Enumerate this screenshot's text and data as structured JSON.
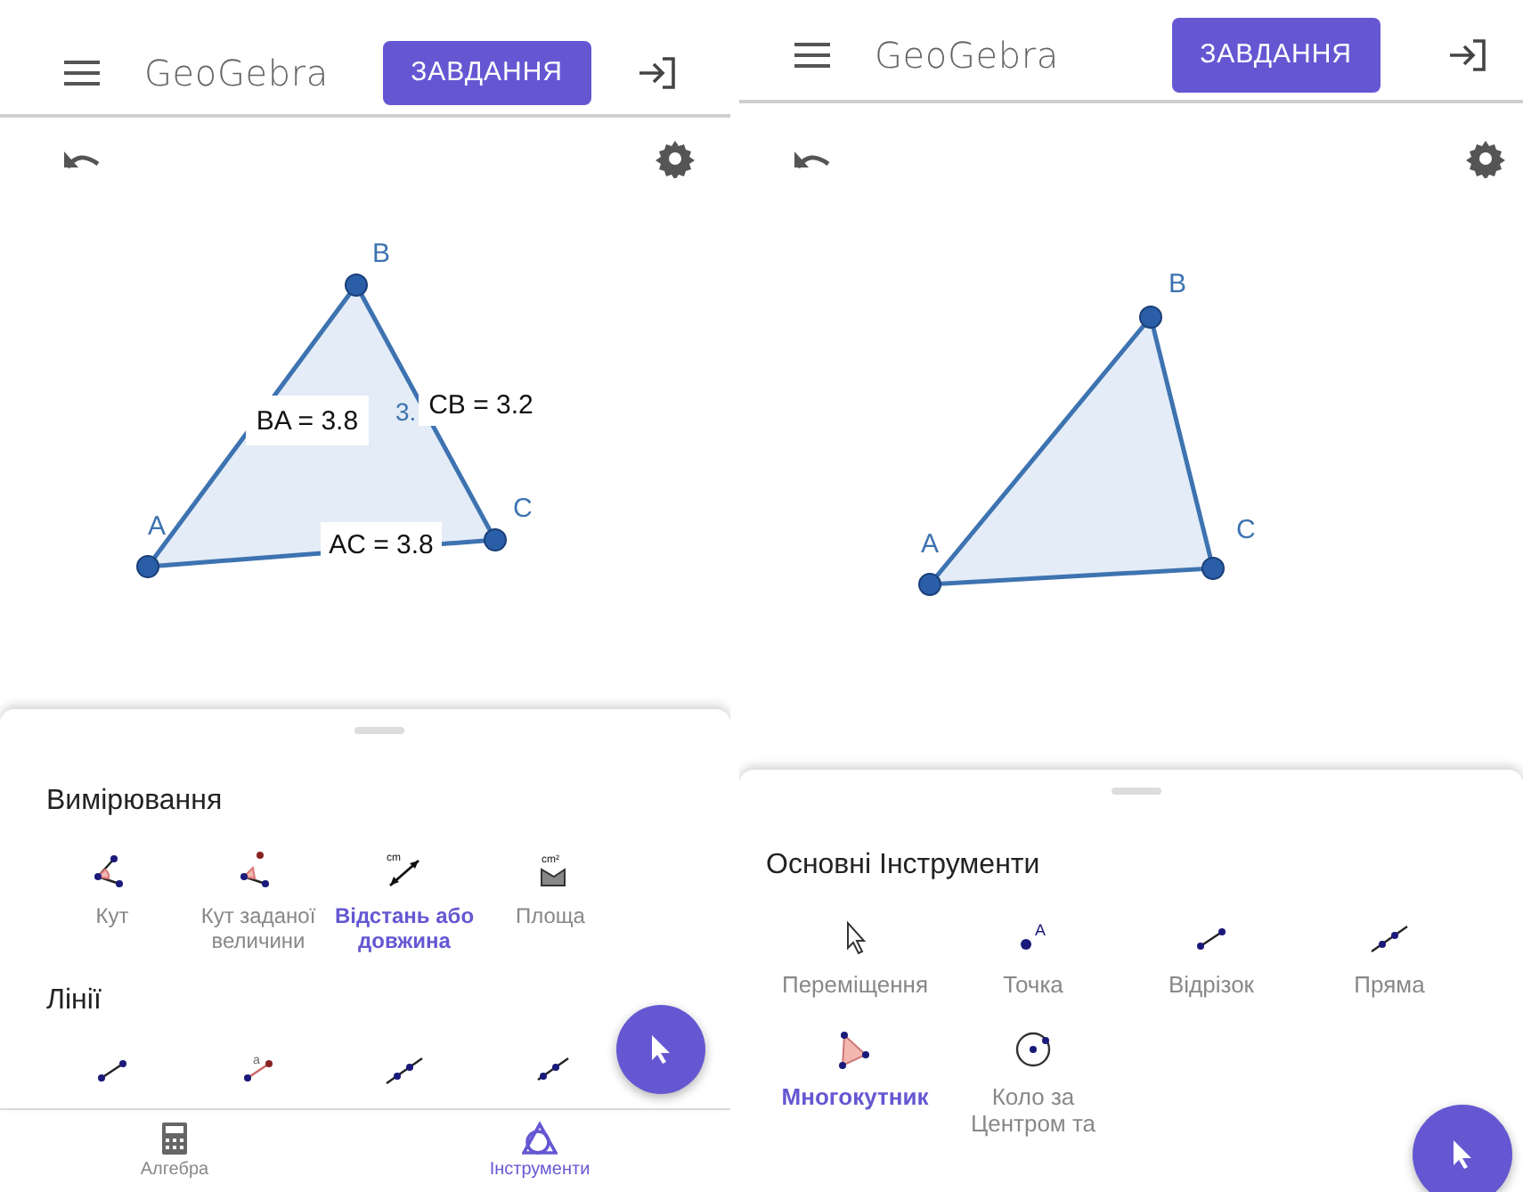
{
  "screens": [
    {
      "header": {
        "logo": "GeoGebra",
        "button": "ЗАВДАННЯ"
      },
      "construction": {
        "points": [
          {
            "label": "A"
          },
          {
            "label": "B"
          },
          {
            "label": "C"
          }
        ],
        "measures": [
          {
            "text": "BA = 3.8"
          },
          {
            "text": "CB = 3.2"
          },
          {
            "text": "AC = 3.8"
          }
        ],
        "hidden_label": "3."
      },
      "tool_sections": [
        {
          "title": "Вимірювання",
          "tools": [
            {
              "kind": "angle",
              "label": "Кут",
              "selected": false
            },
            {
              "kind": "fixedangle",
              "label": "Кут заданої величини",
              "selected": false
            },
            {
              "kind": "distance",
              "icon_text": "cm",
              "label": "Відстань або довжина",
              "selected": true
            },
            {
              "kind": "area",
              "icon_text": "cm²",
              "label": "Площа",
              "selected": false
            }
          ]
        },
        {
          "title": "Лінії",
          "tools": [
            {
              "kind": "segment",
              "selected": false
            },
            {
              "kind": "fixedsegment",
              "icon_text": "a",
              "selected": false
            },
            {
              "kind": "line",
              "selected": false
            },
            {
              "kind": "ray",
              "selected": false
            }
          ]
        }
      ],
      "bottom_nav": [
        {
          "label": "Алгебра",
          "kind": "calculator",
          "selected": false
        },
        {
          "label": "Інструменти",
          "kind": "tools",
          "selected": true
        }
      ]
    },
    {
      "header": {
        "logo": "GeoGebra",
        "button": "ЗАВДАННЯ"
      },
      "construction": {
        "points": [
          {
            "label": "A"
          },
          {
            "label": "B"
          },
          {
            "label": "C"
          }
        ]
      },
      "tool_sections": [
        {
          "title": "Основні Інструменти",
          "tools": [
            {
              "kind": "move",
              "label": "Переміщення",
              "selected": false
            },
            {
              "kind": "point",
              "icon_text": "A",
              "label": "Точка",
              "selected": false
            },
            {
              "kind": "segment",
              "label": "Відрізок",
              "selected": false
            },
            {
              "kind": "line",
              "label": "Пряма",
              "selected": false
            },
            {
              "kind": "polygon",
              "label": "Многокутник",
              "selected": true
            },
            {
              "kind": "circle",
              "label": "Коло за Центром та",
              "selected": false
            }
          ]
        }
      ]
    }
  ]
}
